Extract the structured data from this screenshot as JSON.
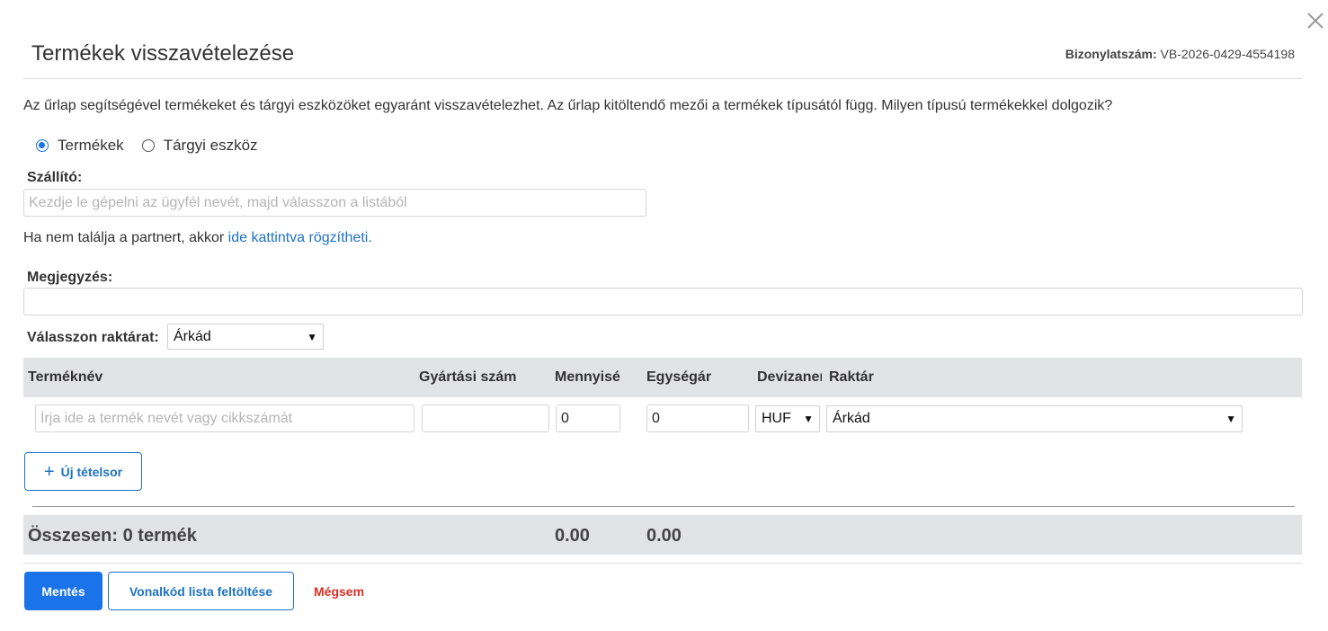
{
  "modal": {
    "title": "Termékek visszavételezése",
    "doc_number_label": "Bizonylatszám:",
    "doc_number_value": "VB-2026-0429-4554198"
  },
  "intro": "Az űrlap segítségével termékeket és tárgyi eszközöket egyaránt visszavételezhet. Az űrlap kitöltendő mezői a termékek típusától függ. Milyen típusú termékekkel dolgozik?",
  "product_type": {
    "options": [
      {
        "label": "Termékek",
        "checked": true
      },
      {
        "label": "Tárgyi eszköz",
        "checked": false
      }
    ]
  },
  "supplier": {
    "label": "Szállító:",
    "placeholder": "Kezdje le gépelni az ügyfél nevét, majd válasszon a listából",
    "value": "",
    "hint_text": "Ha nem találja a partnert, akkor ",
    "hint_link": "ide kattintva rögzítheti."
  },
  "note": {
    "label": "Megjegyzés:",
    "value": ""
  },
  "warehouse": {
    "label": "Válasszon raktárat:",
    "selected": "Árkád"
  },
  "table": {
    "headers": {
      "name": "Terméknév",
      "serial": "Gyártási szám",
      "quantity": "Mennyiség",
      "unit_price": "Egységár",
      "currency": "Devizanem",
      "warehouse": "Raktár"
    },
    "row": {
      "name_placeholder": "Írja ide a termék nevét vagy cikkszámát",
      "serial": "",
      "quantity": "0",
      "unit_price": "0",
      "currency": "HUF",
      "warehouse": "Árkád"
    }
  },
  "buttons": {
    "new_row": "Új tételsor",
    "save": "Mentés",
    "upload": "Vonalkód lista feltöltése",
    "cancel": "Mégsem"
  },
  "total": {
    "label": "Összesen: 0 termék",
    "quantity": "0.00",
    "price": "0.00"
  },
  "colors": {
    "accent": "#1a73e8",
    "link": "#1f73c4",
    "danger": "#d93025",
    "header_bg": "#e2e3e5"
  }
}
